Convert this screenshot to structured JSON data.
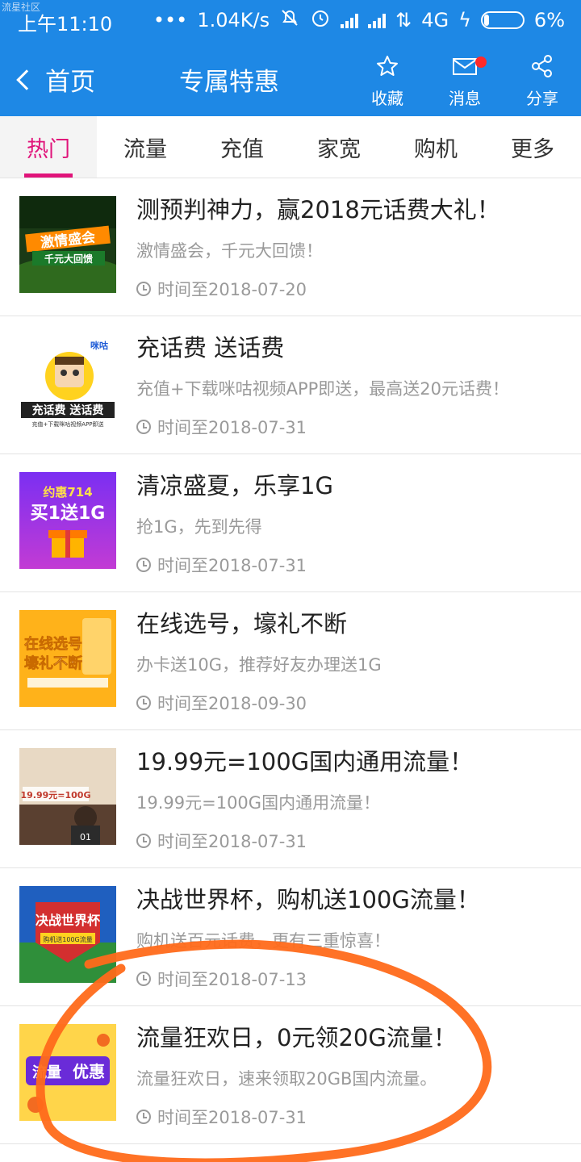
{
  "statusbar": {
    "watermark": "流星社区",
    "time": "上午11:10",
    "speed": "1.04K/s",
    "network": "4G",
    "battery": "6%"
  },
  "header": {
    "back_label": "首页",
    "title": "专属特惠",
    "actions": [
      {
        "label": "收藏",
        "icon": "star-icon"
      },
      {
        "label": "消息",
        "icon": "mail-icon"
      },
      {
        "label": "分享",
        "icon": "share-icon"
      }
    ]
  },
  "tabs": [
    "热门",
    "流量",
    "充值",
    "家宽",
    "购机",
    "更多"
  ],
  "active_tab": "热门",
  "promos": [
    {
      "title": "测预判神力，赢2018元话费大礼！",
      "subtitle": "激情盛会，千元大回馈！",
      "time": "时间至2018-07-20",
      "thumb_text": [
        "激情盛会",
        "千元大回馈"
      ]
    },
    {
      "title": "充话费 送话费",
      "subtitle": "充值+下载咪咕视频APP即送，最高送20元话费！",
      "time": "时间至2018-07-31",
      "thumb_text": [
        "充话费 送话费",
        "充值+下载咪咕视频APP即送",
        "咪咕"
      ]
    },
    {
      "title": "清凉盛夏，乐享1G",
      "subtitle": "抢1G，先到先得",
      "time": "时间至2018-07-31",
      "thumb_text": [
        "约惠714",
        "买1送1G"
      ]
    },
    {
      "title": "在线选号，壕礼不断",
      "subtitle": "办卡送10G，推荐好友办理送1G",
      "time": "时间至2018-09-30",
      "thumb_text": [
        "在线选号",
        "壕礼不断"
      ]
    },
    {
      "title": "19.99元=100G国内通用流量！",
      "subtitle": "19.99元=100G国内通用流量！",
      "time": "时间至2018-07-31",
      "thumb_text": [
        "19.99元=100G",
        "01"
      ]
    },
    {
      "title": "决战世界杯，购机送100G流量！",
      "subtitle": "购机送百元话费，更有三重惊喜！",
      "time": "时间至2018-07-13",
      "thumb_text": [
        "决战世界杯",
        "购机送100G流量"
      ]
    },
    {
      "title": "流量狂欢日，0元领20G流量！",
      "subtitle": "流量狂欢日，速来领取20GB国内流量。",
      "time": "时间至2018-07-31",
      "thumb_text": [
        "流量",
        "优惠"
      ]
    }
  ],
  "colors": {
    "accent": "#1e88e5",
    "tab_active": "#e0147a",
    "annotation": "#ff6a1a"
  }
}
